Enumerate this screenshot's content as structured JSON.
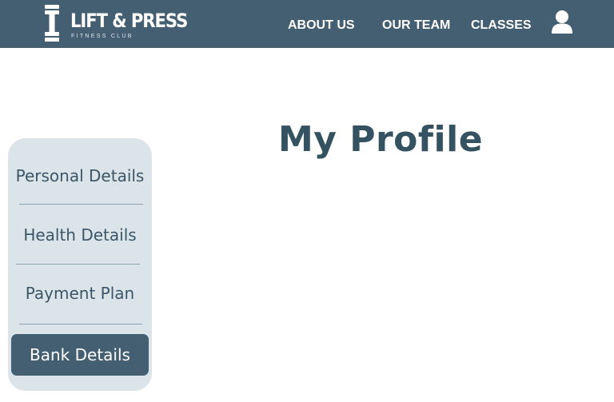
{
  "header": {
    "logo": {
      "title": "LIFT & PRESS",
      "subtitle": "FITNESS CLUB",
      "icon": "barbell-icon"
    },
    "nav": [
      {
        "label": "ABOUT US"
      },
      {
        "label": "OUR TEAM"
      },
      {
        "label": "CLASSES"
      }
    ],
    "account_icon": "user-icon"
  },
  "main": {
    "title": "My Profile"
  },
  "sidebar": {
    "items": [
      {
        "label": "Personal Details",
        "active": false
      },
      {
        "label": "Health Details",
        "active": false
      },
      {
        "label": "Payment Plan",
        "active": false
      },
      {
        "label": "Bank Details",
        "active": true
      }
    ]
  },
  "colors": {
    "header_bg": "#455f72",
    "sidebar_bg": "#dbe4e9",
    "active_item_bg": "#455f72",
    "text_primary": "#34525f",
    "divider": "#8aa3b2"
  }
}
